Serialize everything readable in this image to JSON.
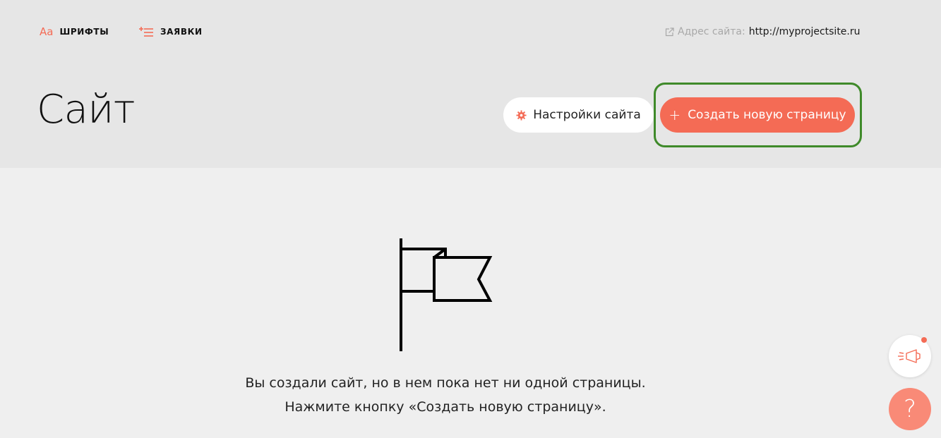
{
  "topnav": {
    "fonts": {
      "icon_text": "Aa",
      "label": "ШРИФТЫ"
    },
    "requests": {
      "icon": "list-plus-icon",
      "label": "ЗАЯВКИ"
    }
  },
  "site_address": {
    "icon": "external-link-icon",
    "label": "Адрес сайта:",
    "url": "http://myprojectsite.ru"
  },
  "page": {
    "title": "Сайт"
  },
  "buttons": {
    "settings": {
      "icon": "gear-icon",
      "label": "Настройки сайта"
    },
    "create_page": {
      "icon": "plus-icon",
      "plus_glyph": "+",
      "label": "Создать новую страницу"
    }
  },
  "empty_state": {
    "icon": "flag-icon",
    "line1": "Вы создали сайт, но в нем пока нет ни одной страницы.",
    "line2": "Нажмите кнопку «Создать новую страницу»."
  },
  "floating": {
    "announcements_icon": "megaphone-icon",
    "help_glyph": "?"
  },
  "colors": {
    "accent": "#f46b55",
    "header_bg": "#e6e6e6",
    "body_bg": "#efefef",
    "highlight": "#3f8a2a"
  }
}
